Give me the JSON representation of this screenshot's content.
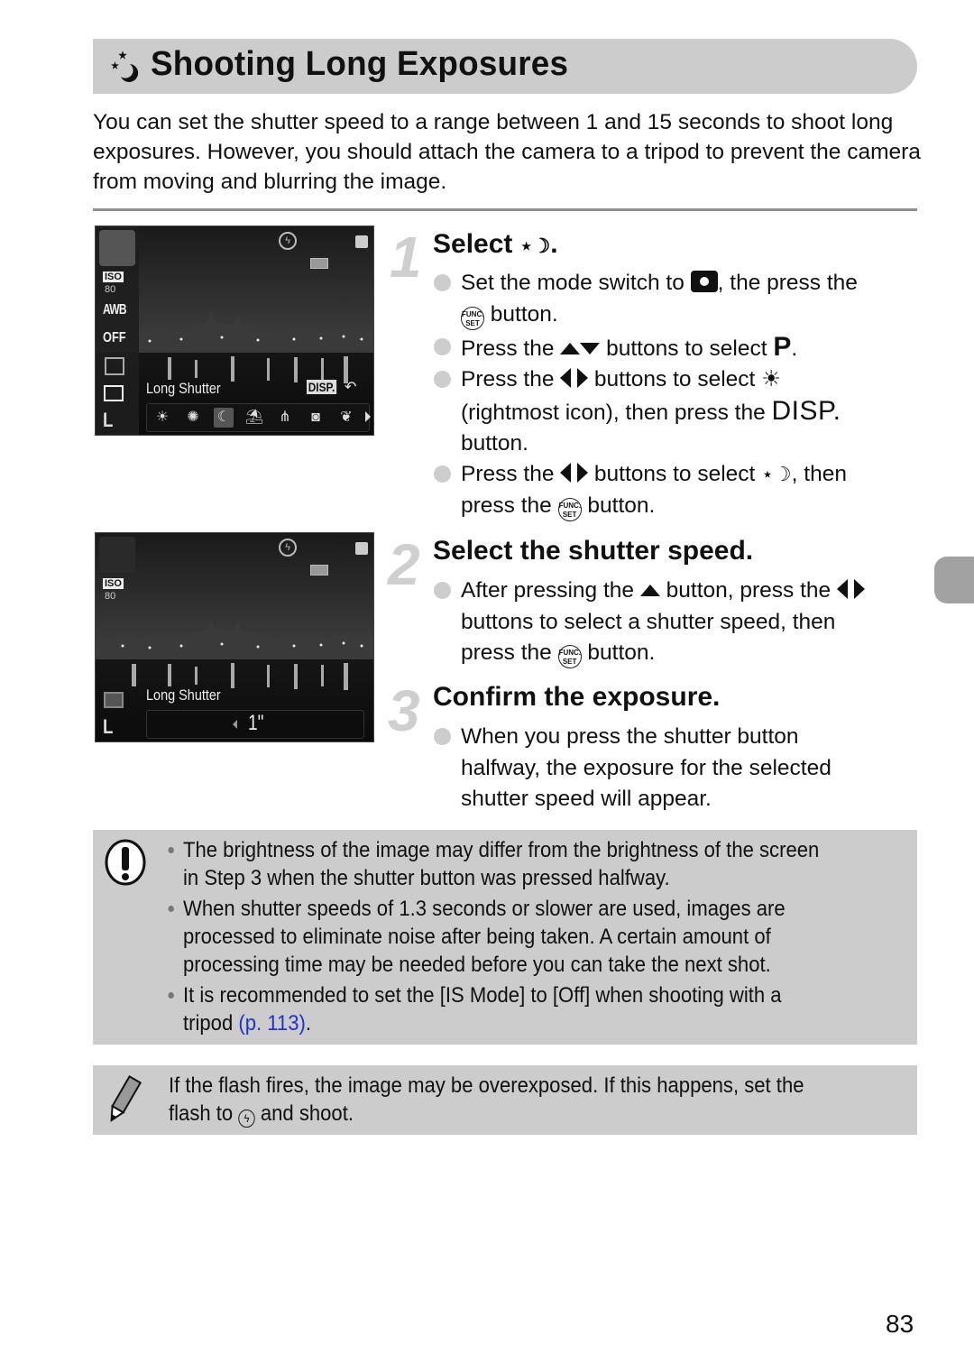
{
  "header": {
    "icon": "night-scene-icon",
    "title": "Shooting Long Exposures"
  },
  "intro": "You can set the shutter speed to a range between 1 and 15 seconds to shoot long exposures. However, you should attach the camera to a tripod to prevent the camera from moving and blurring the image.",
  "screens": [
    {
      "label": "Long Shutter",
      "iso_label": "ISO",
      "iso_value": "80",
      "wb": "AWB",
      "flash": "OFF",
      "disp": "DISP.",
      "strip_icons": [
        "sunset-icon",
        "fireworks-icon",
        "long-shutter-icon",
        "beach-icon",
        "aquarium-icon",
        "underwater-icon",
        "foliage-icon"
      ]
    },
    {
      "label": "Long Shutter",
      "iso_label": "ISO",
      "iso_value": "80",
      "shutter_speed": "1\""
    }
  ],
  "steps": [
    {
      "number": "1",
      "title": "Select",
      "bullets": [
        {
          "a": "Set the mode switch to ",
          "b": ", the press the",
          "c": " button."
        },
        {
          "a": "Press the ",
          "b": " buttons to select ",
          "c": "P",
          "d": "."
        },
        {
          "a": "Press the ",
          "b": " buttons to select ",
          "c": "(rightmost icon), then press the ",
          "d": "DISP.",
          "e": "button."
        },
        {
          "a": "Press the ",
          "b": " buttons to select ",
          "c": ", then",
          "d": "press the ",
          "e": " button."
        }
      ]
    },
    {
      "number": "2",
      "title": "Select the shutter speed.",
      "bullets": [
        {
          "a": "After pressing the ",
          "b": " button, press the ",
          "c": "buttons to select a shutter speed, then",
          "d": "press the ",
          "e": " button."
        }
      ]
    },
    {
      "number": "3",
      "title": "Confirm the exposure.",
      "bullets": [
        {
          "a": "When you press the shutter button",
          "b": "halfway, the exposure for the selected",
          "c": "shutter speed will appear."
        }
      ]
    }
  ],
  "func_label": {
    "top": "FUNC.",
    "bottom": "SET"
  },
  "caution": {
    "icon": "caution-icon",
    "items": [
      [
        "The brightness of the image may differ from the brightness of the screen",
        "in Step 3 when the shutter button was pressed halfway."
      ],
      [
        "When shutter speeds of 1.3 seconds or slower are used, images are",
        "processed to eliminate noise after being taken. A certain amount of",
        "processing time may be needed before you can take the next shot."
      ],
      [
        "It is recommended to set the [IS Mode] to [Off] when shooting with a",
        "tripod ",
        "(p. 113)",
        "."
      ]
    ]
  },
  "tip": {
    "icon": "pencil-icon",
    "line1": "If the flash fires, the image may be overexposed. If this happens, set the",
    "line2a": "flash to ",
    "line2b": " and shoot."
  },
  "page_number": "83",
  "colors": {
    "title_bar": "#cccccc",
    "box_bg": "#cccccc",
    "link": "#2233cc",
    "step_number": "#cfcfcf",
    "side_tab": "#a2a2a2"
  }
}
